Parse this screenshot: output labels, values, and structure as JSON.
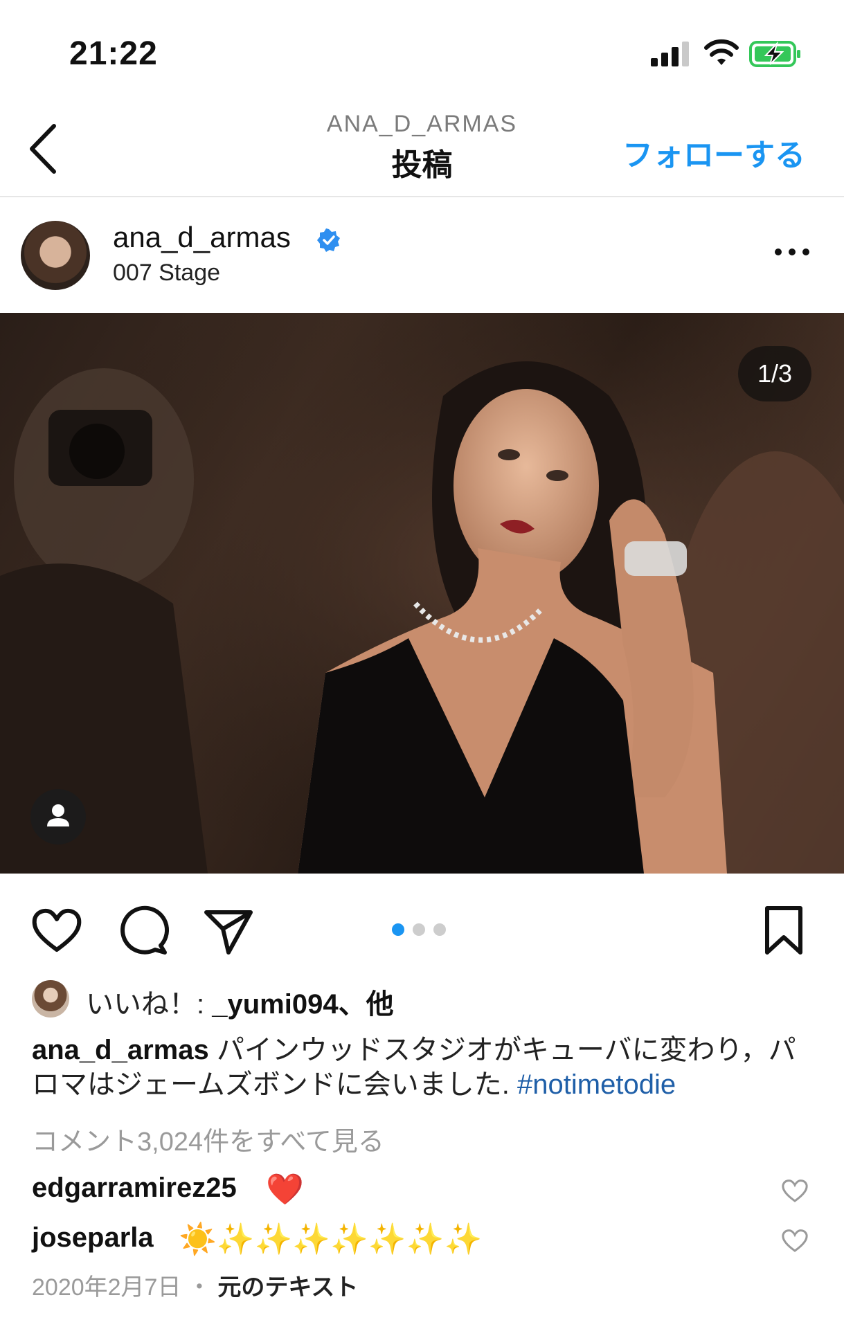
{
  "status": {
    "time": "21:22"
  },
  "nav": {
    "subtitle": "ANA_D_ARMAS",
    "title": "投稿",
    "follow_label": "フォローする"
  },
  "post": {
    "username": "ana_d_armas",
    "location": "007 Stage",
    "counter": "1/3",
    "likes_prefix": "いいね！: ",
    "likes_user": "_yumi094",
    "likes_suffix": "、他",
    "caption_user": "ana_d_armas",
    "caption_text": " パインウッドスタジオがキューバに変わり，パロマはジェームズボンドに会いました. ",
    "caption_hashtag": "#notimetodie",
    "view_comments": "コメント3,024件をすべて見る",
    "comments": [
      {
        "user": "edgarramirez25",
        "text": "❤️"
      },
      {
        "user": "joseparla",
        "text": "☀️✨✨✨✨✨✨✨"
      }
    ],
    "date": "2020年2月7日",
    "separator": " ・ ",
    "original_text": "元のテキスト"
  },
  "colors": {
    "accent": "#1a95f2",
    "hashtag": "#1f5fa8",
    "muted": "#9a9a9a"
  },
  "carousel": {
    "total": 3,
    "current": 1
  }
}
